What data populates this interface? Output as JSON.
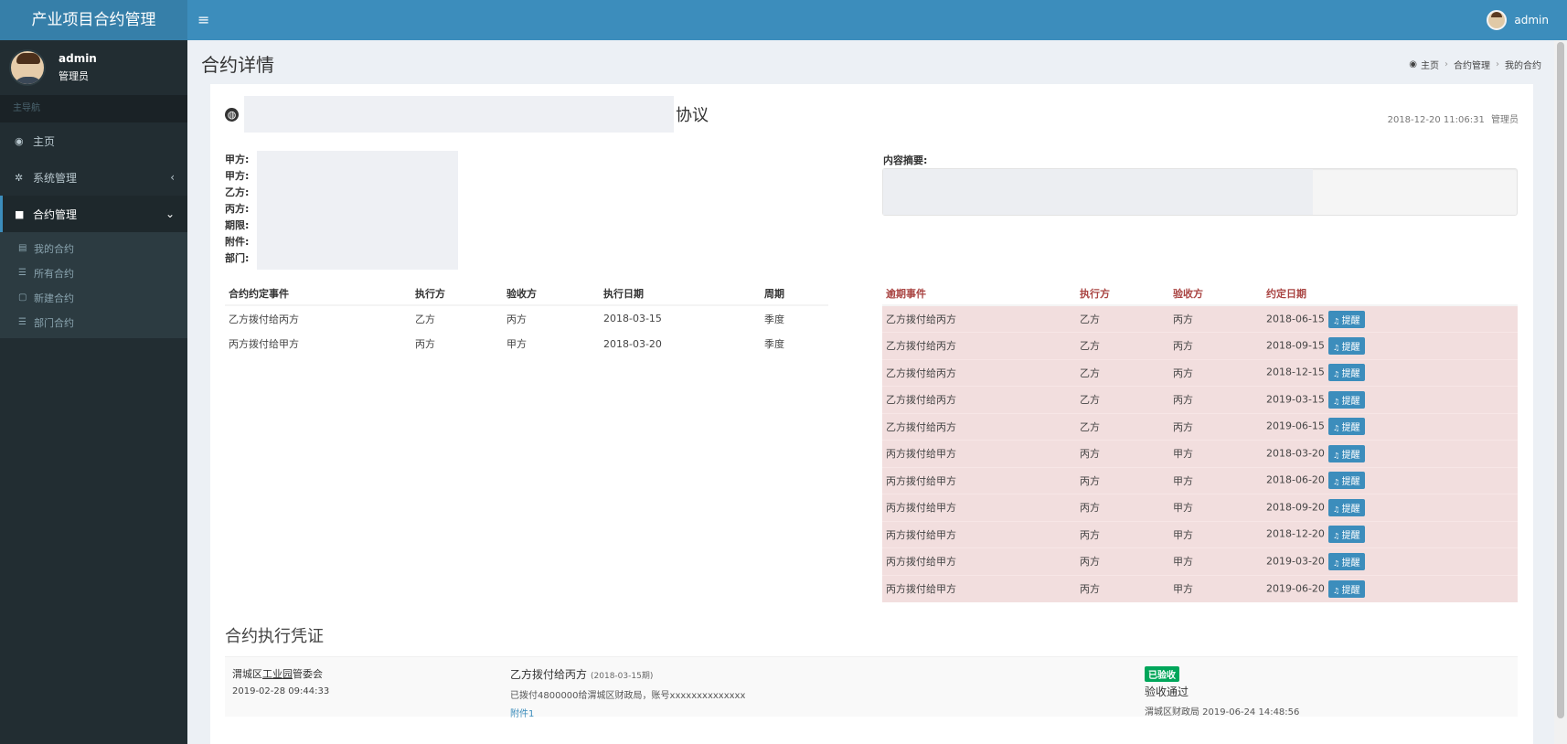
{
  "app": {
    "title": "产业项目合约管理",
    "menu_icon": "hamburger-icon"
  },
  "top_user": {
    "name": "admin"
  },
  "sidebar": {
    "user_name": "admin",
    "user_role": "管理员",
    "header": "主导航",
    "items": [
      {
        "label": "主页",
        "icon": "dashboard-icon"
      },
      {
        "label": "系统管理",
        "icon": "gear-icon"
      },
      {
        "label": "合约管理",
        "icon": "file-icon"
      }
    ],
    "sub_items": [
      {
        "label": "我的合约",
        "icon": "doc-icon"
      },
      {
        "label": "所有合约",
        "icon": "list-icon"
      },
      {
        "label": "新建合约",
        "icon": "file-new-icon"
      },
      {
        "label": "部门合约",
        "icon": "list-icon"
      }
    ]
  },
  "page": {
    "title": "合约详情",
    "breadcrumb": [
      "主页",
      "合约管理",
      "我的合约"
    ]
  },
  "contract": {
    "title_suffix": "协议",
    "date": "2018-12-20 11:06:31",
    "author": "管理员",
    "party_labels": [
      "甲方:",
      "甲方:",
      "乙方:",
      "丙方:",
      "期限:",
      "附件:",
      "部门:"
    ],
    "summary_label": "内容摘要:"
  },
  "events_table": {
    "headers": [
      "合约约定事件",
      "执行方",
      "验收方",
      "执行日期",
      "周期"
    ],
    "rows": [
      [
        "乙方拨付给丙方",
        "乙方",
        "丙方",
        "2018-03-15",
        "季度"
      ],
      [
        "丙方拨付给甲方",
        "丙方",
        "甲方",
        "2018-03-20",
        "季度"
      ]
    ]
  },
  "overdue_table": {
    "headers": [
      "逾期事件",
      "执行方",
      "验收方",
      "约定日期"
    ],
    "remind_label": "提醒",
    "rows": [
      [
        "乙方拨付给丙方",
        "乙方",
        "丙方",
        "2018-06-15"
      ],
      [
        "乙方拨付给丙方",
        "乙方",
        "丙方",
        "2018-09-15"
      ],
      [
        "乙方拨付给丙方",
        "乙方",
        "丙方",
        "2018-12-15"
      ],
      [
        "乙方拨付给丙方",
        "乙方",
        "丙方",
        "2019-03-15"
      ],
      [
        "乙方拨付给丙方",
        "乙方",
        "丙方",
        "2019-06-15"
      ],
      [
        "丙方拨付给甲方",
        "丙方",
        "甲方",
        "2018-03-20"
      ],
      [
        "丙方拨付给甲方",
        "丙方",
        "甲方",
        "2018-06-20"
      ],
      [
        "丙方拨付给甲方",
        "丙方",
        "甲方",
        "2018-09-20"
      ],
      [
        "丙方拨付给甲方",
        "丙方",
        "甲方",
        "2018-12-20"
      ],
      [
        "丙方拨付给甲方",
        "丙方",
        "甲方",
        "2019-03-20"
      ],
      [
        "丙方拨付给甲方",
        "丙方",
        "甲方",
        "2019-06-20"
      ]
    ]
  },
  "voucher": {
    "section_title": "合约执行凭证",
    "org_prefix": "渭城区",
    "org_underlined": "工业园",
    "org_suffix": "管委会",
    "submitted": "2019-02-28 09:44:33",
    "event": "乙方拨付给丙方",
    "period": "(2018-03-15期)",
    "desc": "已拨付4800000给渭城区财政局，账号xxxxxxxxxxxxxx",
    "attachment": "附件1",
    "badge": "已验收",
    "status": "验收通过",
    "reviewed_by": "渭城区财政局 2019-06-24 14:48:56"
  },
  "colors": {
    "topbar": "#3c8dbc",
    "sidebar": "#222d32",
    "overdue_row": "#f2dede",
    "overdue_header": "#a94442",
    "badge": "#00a65a"
  }
}
